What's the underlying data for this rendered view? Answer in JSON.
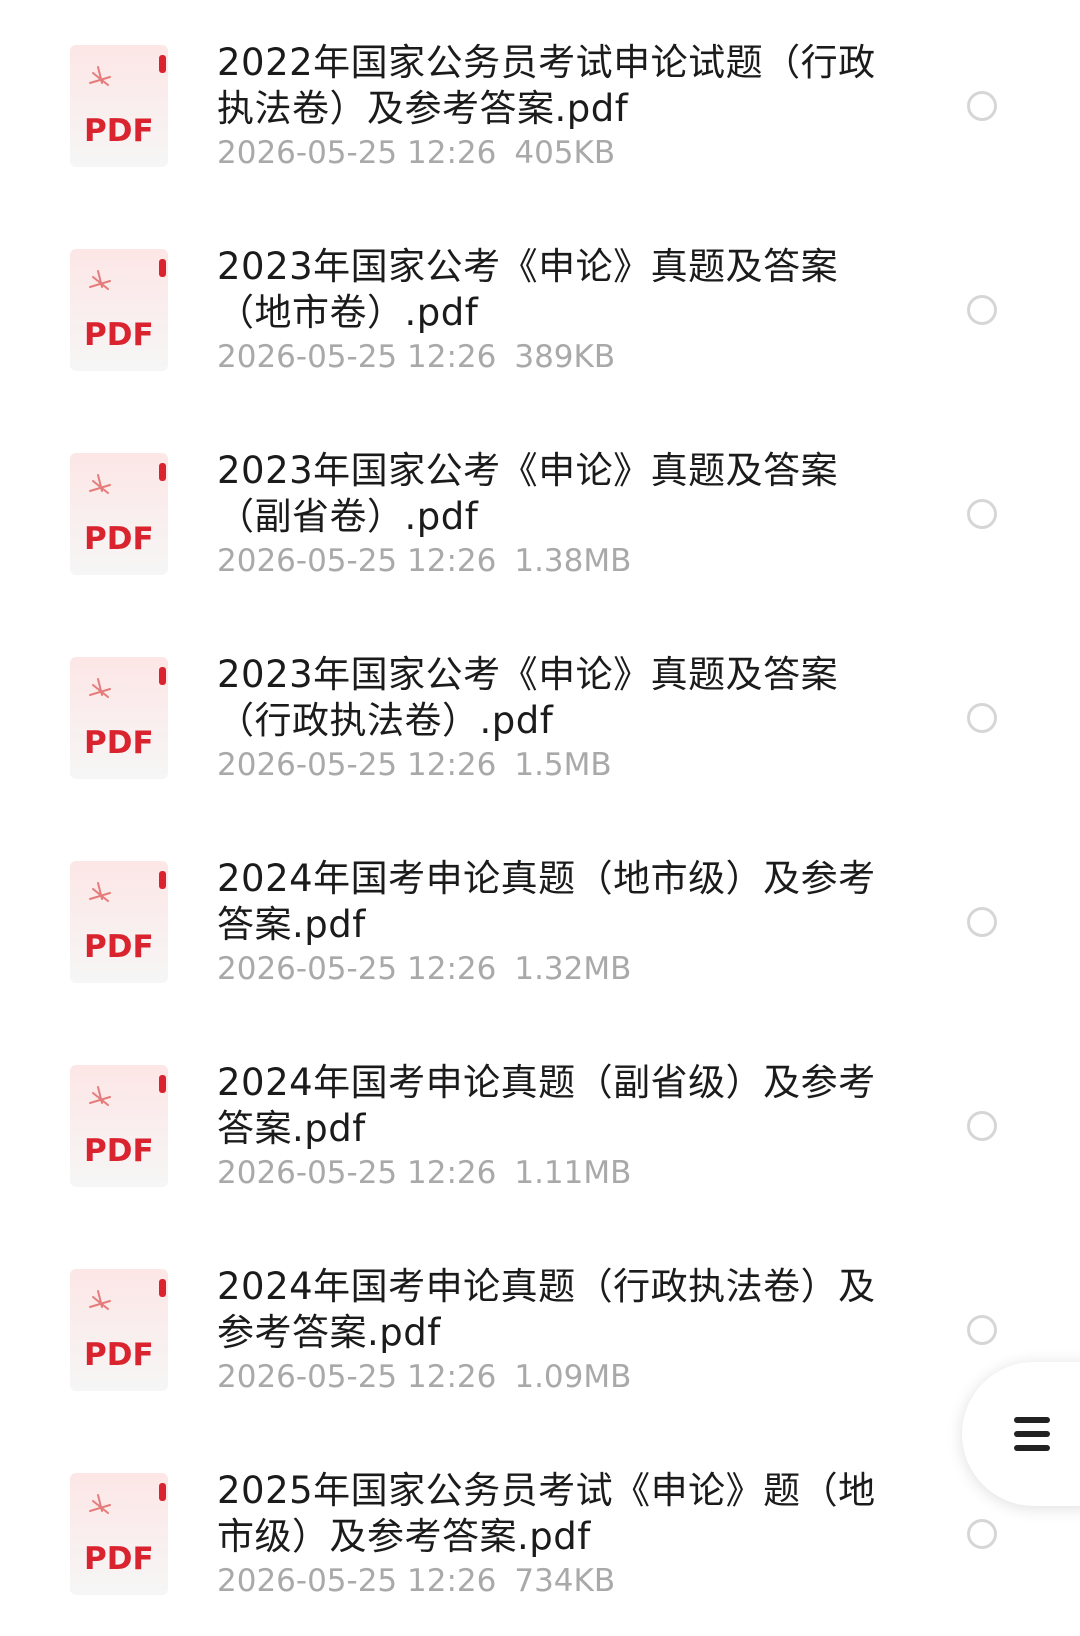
{
  "icons": {
    "file": "pdf-file-icon",
    "select": "radio-circle-icon",
    "menu": "menu-icon"
  },
  "colors": {
    "pdf_red": "#d9232e",
    "meta_gray": "#a9a9a9",
    "title_text": "#1b1b1b"
  },
  "files": [
    {
      "icon_text": "PDF",
      "name": "2022年国家公务员考试申论试题（行政执法卷）及参考答案.pdf",
      "datetime": "2026-05-25 12:26",
      "size": "405KB"
    },
    {
      "icon_text": "PDF",
      "name": "2023年国家公考《申论》真题及答案（地市卷）.pdf",
      "datetime": "2026-05-25 12:26",
      "size": "389KB"
    },
    {
      "icon_text": "PDF",
      "name": "2023年国家公考《申论》真题及答案（副省卷）.pdf",
      "datetime": "2026-05-25 12:26",
      "size": "1.38MB"
    },
    {
      "icon_text": "PDF",
      "name": "2023年国家公考《申论》真题及答案（行政执法卷）.pdf",
      "datetime": "2026-05-25 12:26",
      "size": "1.5MB"
    },
    {
      "icon_text": "PDF",
      "name": "2024年国考申论真题（地市级）及参考答案.pdf",
      "datetime": "2026-05-25 12:26",
      "size": "1.32MB"
    },
    {
      "icon_text": "PDF",
      "name": "2024年国考申论真题（副省级）及参考答案.pdf",
      "datetime": "2026-05-25 12:26",
      "size": "1.11MB"
    },
    {
      "icon_text": "PDF",
      "name": "2024年国考申论真题（行政执法卷）及参考答案.pdf",
      "datetime": "2026-05-25 12:26",
      "size": "1.09MB"
    },
    {
      "icon_text": "PDF",
      "name": "2025年国家公务员考试《申论》题（地市级）及参考答案.pdf",
      "datetime": "2026-05-25 12:26",
      "size": "734KB"
    }
  ]
}
